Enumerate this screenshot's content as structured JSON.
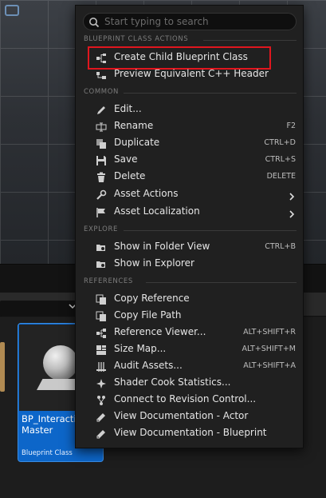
{
  "menu": {
    "search": {
      "placeholder": "Start typing to search",
      "value": ""
    },
    "sections": {
      "blueprint": "BLUEPRINT CLASS ACTIONS",
      "common": "COMMON",
      "explore": "EXPLORE",
      "references": "REFERENCES"
    },
    "items": {
      "create_child": {
        "label": "Create Child Blueprint Class",
        "icon": "hierarchy-icon"
      },
      "preview_cpp": {
        "label": "Preview Equivalent C++ Header",
        "icon": "code-icon"
      },
      "edit": {
        "label": "Edit...",
        "icon": "pencil-icon"
      },
      "rename": {
        "label": "Rename",
        "shortcut": "F2",
        "icon": "rename-icon"
      },
      "duplicate": {
        "label": "Duplicate",
        "shortcut": "CTRL+D",
        "icon": "duplicate-icon"
      },
      "save": {
        "label": "Save",
        "shortcut": "CTRL+S",
        "icon": "save-icon"
      },
      "delete": {
        "label": "Delete",
        "shortcut": "DELETE",
        "icon": "trash-icon"
      },
      "asset_actions": {
        "label": "Asset Actions",
        "icon": "wrench-icon"
      },
      "asset_localization": {
        "label": "Asset Localization",
        "icon": "flag-icon"
      },
      "show_folder": {
        "label": "Show in Folder View",
        "shortcut": "CTRL+B",
        "icon": "folder-search-icon"
      },
      "show_explorer": {
        "label": "Show in Explorer",
        "icon": "folder-search-icon"
      },
      "copy_reference": {
        "label": "Copy Reference",
        "icon": "copy-icon"
      },
      "copy_path": {
        "label": "Copy File Path",
        "icon": "copy-icon"
      },
      "reference_viewer": {
        "label": "Reference Viewer...",
        "shortcut": "ALT+SHIFT+R",
        "icon": "graph-icon"
      },
      "size_map": {
        "label": "Size Map...",
        "shortcut": "ALT+SHIFT+M",
        "icon": "grid-icon"
      },
      "audit_assets": {
        "label": "Audit Assets...",
        "shortcut": "ALT+SHIFT+A",
        "icon": "audit-icon"
      },
      "shader_stats": {
        "label": "Shader Cook Statistics...",
        "icon": "sparkle-icon"
      },
      "revision_control": {
        "label": "Connect to Revision Control...",
        "icon": "branch-icon"
      },
      "doc_actor": {
        "label": "View Documentation - Actor",
        "icon": "book-icon"
      },
      "doc_blueprint": {
        "label": "View Documentation - Blueprint",
        "icon": "book-icon"
      }
    }
  },
  "asset": {
    "name": "BP_InteractionMaster",
    "name_visible_line1": "BP_Interactio",
    "name_visible_line2": "Master",
    "type": "Blueprint Class",
    "thumbnail_icon": "sphere-on-plinth-icon"
  },
  "colors": {
    "menu_bg": "#202020",
    "highlight": "#e0161e",
    "asset_selected": "#0d66c9",
    "folder": "#b08a52"
  }
}
